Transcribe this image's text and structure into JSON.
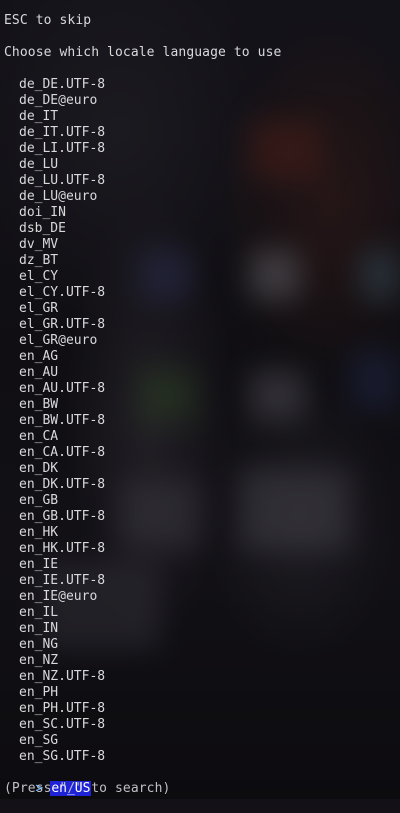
{
  "header": {
    "skip_hint": "ESC to skip",
    "prompt": "Choose which locale language to use"
  },
  "locales": [
    "de_DE.UTF-8",
    "de_DE@euro",
    "de_IT",
    "de_IT.UTF-8",
    "de_LI.UTF-8",
    "de_LU",
    "de_LU.UTF-8",
    "de_LU@euro",
    "doi_IN",
    "dsb_DE",
    "dv_MV",
    "dz_BT",
    "el_CY",
    "el_CY.UTF-8",
    "el_GR",
    "el_GR.UTF-8",
    "el_GR@euro",
    "en_AG",
    "en_AU",
    "en_AU.UTF-8",
    "en_BW",
    "en_BW.UTF-8",
    "en_CA",
    "en_CA.UTF-8",
    "en_DK",
    "en_DK.UTF-8",
    "en_GB",
    "en_GB.UTF-8",
    "en_HK",
    "en_HK.UTF-8",
    "en_IE",
    "en_IE.UTF-8",
    "en_IE@euro",
    "en_IL",
    "en_IN",
    "en_NG",
    "en_NZ",
    "en_NZ.UTF-8",
    "en_PH",
    "en_PH.UTF-8",
    "en_SC.UTF-8",
    "en_SG",
    "en_SG.UTF-8"
  ],
  "selected": {
    "cursor": ">",
    "label": "en_US"
  },
  "footer": {
    "search_hint": "(Press \"/\" to search)"
  },
  "colors": {
    "selection_bg": "#1f23d6",
    "cursor": "#5fb0ff",
    "text": "#d9d9dc"
  }
}
